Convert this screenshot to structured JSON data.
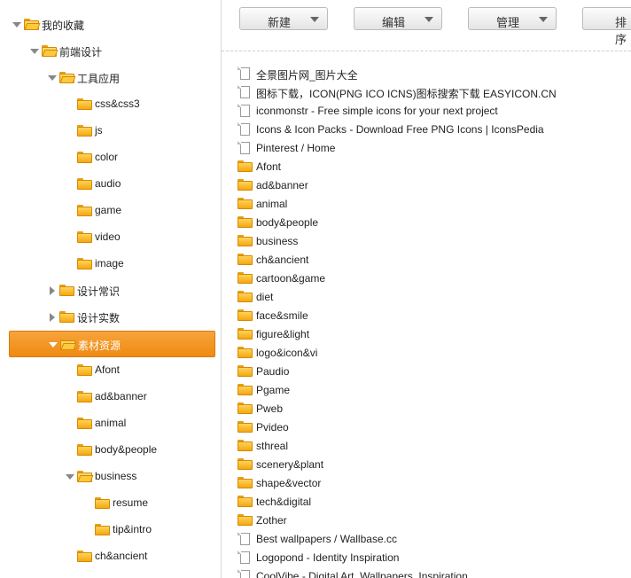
{
  "tree": [
    {
      "label": "我的收藏",
      "expand": "open",
      "open": true,
      "selected": false
    },
    {
      "label": "前端设计",
      "expand": "open",
      "open": true,
      "selected": false
    },
    {
      "label": "工具应用",
      "expand": "open",
      "open": true,
      "selected": false
    },
    {
      "label": "css&css3",
      "expand": "none",
      "open": false,
      "selected": false
    },
    {
      "label": "js",
      "expand": "none",
      "open": false,
      "selected": false
    },
    {
      "label": "color",
      "expand": "none",
      "open": false,
      "selected": false
    },
    {
      "label": "audio",
      "expand": "none",
      "open": false,
      "selected": false
    },
    {
      "label": "game",
      "expand": "none",
      "open": false,
      "selected": false
    },
    {
      "label": "video",
      "expand": "none",
      "open": false,
      "selected": false
    },
    {
      "label": "image",
      "expand": "none",
      "open": false,
      "selected": false
    },
    {
      "label": "设计常识",
      "expand": "closed",
      "open": false,
      "selected": false
    },
    {
      "label": "设计实数",
      "expand": "closed",
      "open": false,
      "selected": false
    },
    {
      "label": "素材资源",
      "expand": "open",
      "open": true,
      "selected": true
    },
    {
      "label": "Afont",
      "expand": "none",
      "open": false,
      "selected": false
    },
    {
      "label": "ad&banner",
      "expand": "none",
      "open": false,
      "selected": false
    },
    {
      "label": "animal",
      "expand": "none",
      "open": false,
      "selected": false
    },
    {
      "label": "body&people",
      "expand": "none",
      "open": false,
      "selected": false
    },
    {
      "label": "business",
      "expand": "open",
      "open": true,
      "selected": false
    },
    {
      "label": "resume",
      "expand": "none",
      "open": false,
      "selected": false
    },
    {
      "label": "tip&intro",
      "expand": "none",
      "open": false,
      "selected": false
    },
    {
      "label": "ch&ancient",
      "expand": "none",
      "open": false,
      "selected": false
    }
  ],
  "toolbar": {
    "new_label": "新建",
    "edit_label": "编辑",
    "manage_label": "管理",
    "sort_label": "排序"
  },
  "items": [
    {
      "type": "file",
      "label": "全景图片网_图片大全"
    },
    {
      "type": "file",
      "label": "图标下载，ICON(PNG ICO ICNS)图标搜索下载 EASYICON.CN"
    },
    {
      "type": "file",
      "label": "iconmonstr - Free simple icons for your next project"
    },
    {
      "type": "file",
      "label": "Icons & Icon Packs - Download Free PNG Icons | IconsPedia"
    },
    {
      "type": "file",
      "label": "Pinterest / Home"
    },
    {
      "type": "folder",
      "label": "Afont"
    },
    {
      "type": "folder",
      "label": "ad&banner"
    },
    {
      "type": "folder",
      "label": "animal"
    },
    {
      "type": "folder",
      "label": "body&people"
    },
    {
      "type": "folder",
      "label": "business"
    },
    {
      "type": "folder",
      "label": "ch&ancient"
    },
    {
      "type": "folder",
      "label": "cartoon&game"
    },
    {
      "type": "folder",
      "label": "diet"
    },
    {
      "type": "folder",
      "label": "face&smile"
    },
    {
      "type": "folder",
      "label": "figure&light"
    },
    {
      "type": "folder",
      "label": "logo&icon&vi"
    },
    {
      "type": "folder",
      "label": "Paudio"
    },
    {
      "type": "folder",
      "label": "Pgame"
    },
    {
      "type": "folder",
      "label": "Pweb"
    },
    {
      "type": "folder",
      "label": "Pvideo"
    },
    {
      "type": "folder",
      "label": "sthreal"
    },
    {
      "type": "folder",
      "label": "scenery&plant"
    },
    {
      "type": "folder",
      "label": "shape&vector"
    },
    {
      "type": "folder",
      "label": "tech&digital"
    },
    {
      "type": "folder",
      "label": "Zother"
    },
    {
      "type": "file",
      "label": "Best wallpapers / Wallbase.cc"
    },
    {
      "type": "file",
      "label": "Logopond - Identity Inspiration"
    },
    {
      "type": "file",
      "label": "CoolVibe - Digital Art, Wallpapers, Inspiration"
    }
  ]
}
